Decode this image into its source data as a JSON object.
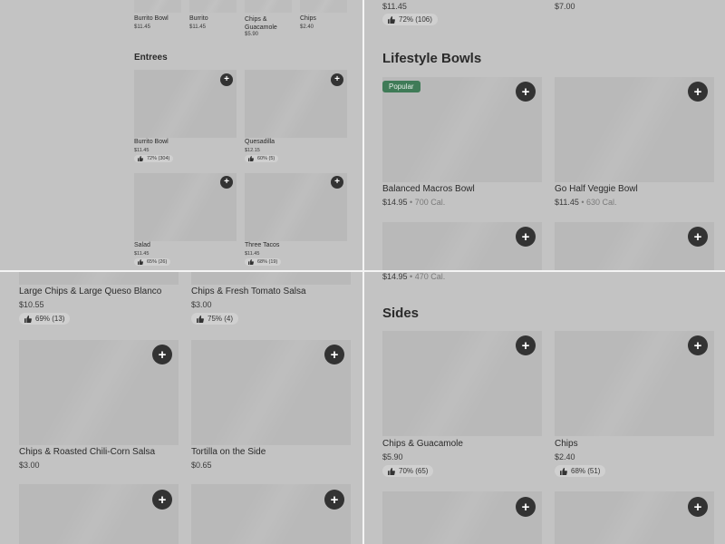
{
  "q1": {
    "top_items": [
      {
        "name": "Burrito Bowl",
        "price": "$11.45"
      },
      {
        "name": "Burrito",
        "price": "$11.45"
      },
      {
        "name": "Chips &\nGuacamole",
        "price": "$5.90"
      },
      {
        "name": "Chips",
        "price": "$2.40"
      }
    ],
    "section_title": "Entrees",
    "items": [
      {
        "name": "Burrito Bowl",
        "price": "$11.45",
        "rating": "72% (304)"
      },
      {
        "name": "Quesadilla",
        "price": "$12.15",
        "rating": "60% (5)"
      },
      {
        "name": "Salad",
        "price": "$11.45",
        "rating": "65% (26)"
      },
      {
        "name": "Three Tacos",
        "price": "$11.45",
        "rating": "68% (19)"
      }
    ]
  },
  "q2": {
    "top_items": [
      {
        "price": "$11.45",
        "rating": "72% (106)"
      },
      {
        "price": "$7.00"
      }
    ],
    "section_title": "Lifestyle Bowls",
    "popular_badge": "Popular",
    "items": [
      {
        "name": "Balanced Macros Bowl",
        "price": "$14.95",
        "cal": "700 Cal."
      },
      {
        "name": "Go Half Veggie Bowl",
        "price": "$11.45",
        "cal": "630 Cal."
      }
    ]
  },
  "q3": {
    "top_items": [
      {
        "name": "Large Chips & Large Queso Blanco",
        "price": "$10.55",
        "rating": "69% (13)"
      },
      {
        "name": "Chips & Fresh Tomato Salsa",
        "price": "$3.00",
        "rating": "75% (4)"
      }
    ],
    "items": [
      {
        "name": "Chips & Roasted Chili-Corn Salsa",
        "price": "$3.00"
      },
      {
        "name": "Tortilla on the Side",
        "price": "$0.65"
      }
    ]
  },
  "q4": {
    "top_price": "$14.95",
    "top_cal": "470 Cal.",
    "section_title": "Sides",
    "items": [
      {
        "name": "Chips & Guacamole",
        "price": "$5.90",
        "rating": "70% (65)"
      },
      {
        "name": "Chips",
        "price": "$2.40",
        "rating": "68% (51)"
      }
    ]
  },
  "icons": {
    "add": "plus-icon",
    "rating": "thumbs-up-icon"
  },
  "colors": {
    "background": "#c3c3c3",
    "add_button": "#333333",
    "popular_badge": "#3f7b57",
    "rating_pill": "#d0d0d0"
  }
}
